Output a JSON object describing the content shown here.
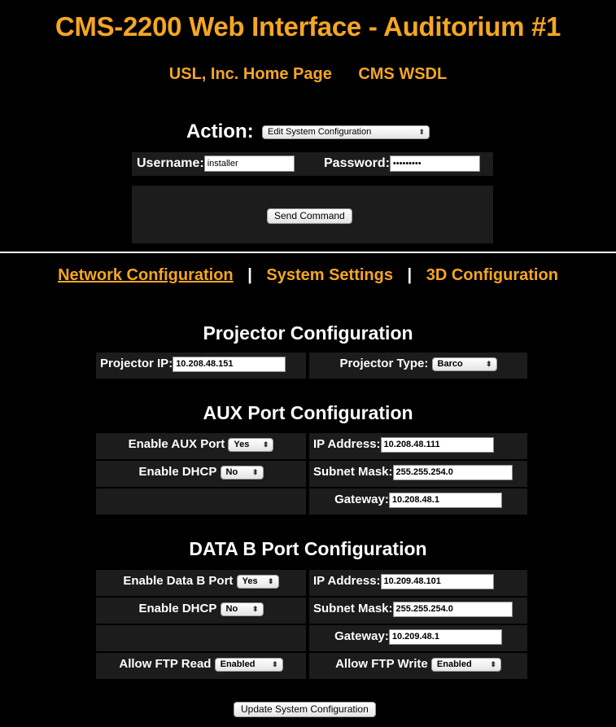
{
  "header": {
    "title": "CMS-2200 Web Interface - Auditorium #1",
    "links": [
      "USL, Inc. Home Page",
      "CMS WSDL"
    ]
  },
  "action": {
    "label": "Action:",
    "selected": "Edit System Configuration",
    "username_label": "Username:",
    "username_value": "installer",
    "password_label": "Password:",
    "password_mask": "•••••••••",
    "send_button": "Send Command"
  },
  "tabs": {
    "network": "Network Configuration",
    "system": "System Settings",
    "three_d": "3D Configuration",
    "separator": "|"
  },
  "projector": {
    "title": "Projector Configuration",
    "ip_label": "Projector IP:",
    "ip_value": "10.208.48.151",
    "type_label": "Projector Type:",
    "type_value": "Barco"
  },
  "aux": {
    "title": "AUX Port Configuration",
    "enable_label": "Enable AUX Port",
    "enable_value": "Yes",
    "dhcp_label": "Enable DHCP",
    "dhcp_value": "No",
    "ip_label": "IP Address:",
    "ip_value": "10.208.48.111",
    "mask_label": "Subnet Mask:",
    "mask_value": "255.255.254.0",
    "gateway_label": "Gateway:",
    "gateway_value": "10.208.48.1"
  },
  "datab": {
    "title": "DATA B Port Configuration",
    "enable_label": "Enable Data B Port",
    "enable_value": "Yes",
    "dhcp_label": "Enable DHCP",
    "dhcp_value": "No",
    "ip_label": "IP Address:",
    "ip_value": "10.209.48.101",
    "mask_label": "Subnet Mask:",
    "mask_value": "255.255.254.0",
    "gateway_label": "Gateway:",
    "gateway_value": "10.209.48.1",
    "ftp_read_label": "Allow FTP Read",
    "ftp_read_value": "Enabled",
    "ftp_write_label": "Allow FTP Write",
    "ftp_write_value": "Enabled"
  },
  "update_button": "Update System Configuration",
  "colors": {
    "accent": "#f5a623",
    "background": "#000000",
    "cell": "#1c1c1c"
  },
  "icons": {
    "select_arrow": "updown-arrow-icon"
  }
}
